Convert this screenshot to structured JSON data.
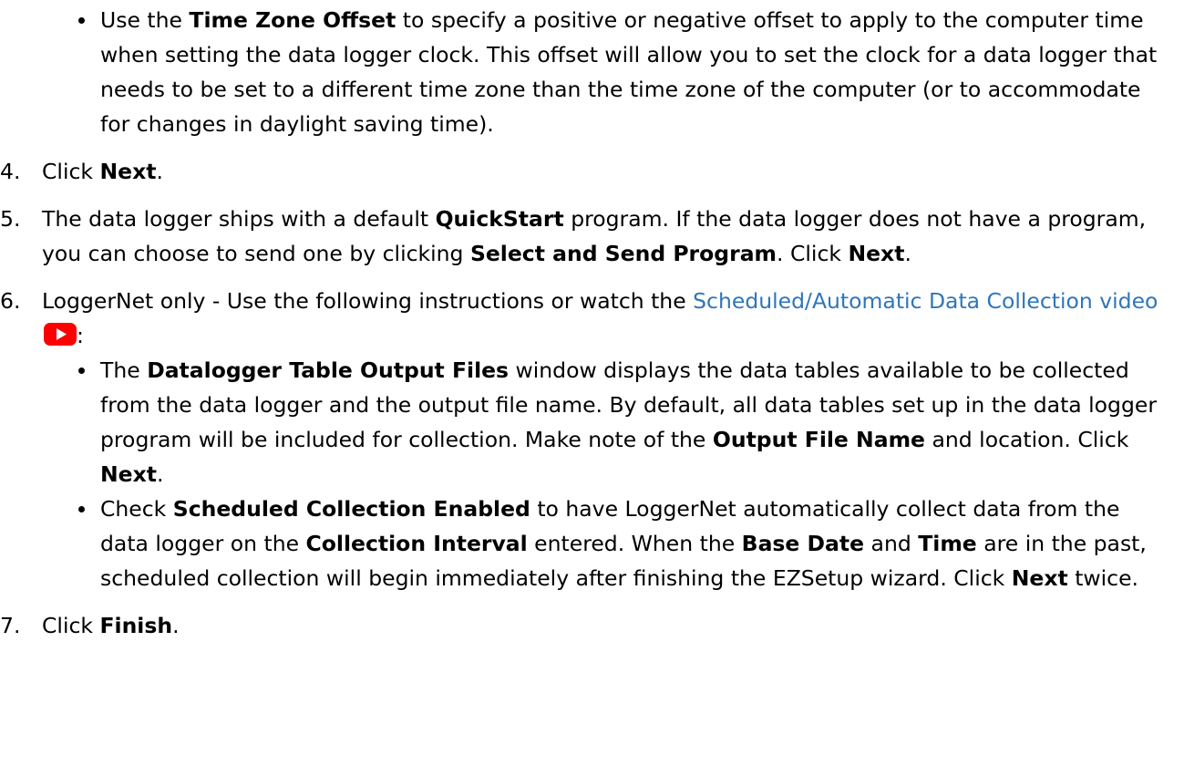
{
  "bullet_time_zone": {
    "pre": "Use the ",
    "bold": "Time Zone Offset",
    "post": " to specify a positive or negative offset to apply to the computer time when setting the data logger clock. This offset will allow you to set the clock for a data logger that needs to be set to a different time zone than the time zone of the computer (or to accommodate for changes in daylight saving time)."
  },
  "step4": {
    "number": "4.",
    "pre": "Click ",
    "bold": "Next",
    "post": "."
  },
  "step5": {
    "number": "5.",
    "t1": "The data logger ships with a default ",
    "b1": "QuickStart",
    "t2": " program. If the data logger does not have a program, you can choose to send one by clicking ",
    "b2": "Select and Send Program",
    "t3": ". Click ",
    "b3": "Next",
    "t4": "."
  },
  "step6": {
    "number": "6.",
    "pre": "LoggerNet only - Use the following instructions or watch the ",
    "link": "Scheduled/Automatic Data Collection video",
    "post": ":",
    "icon": "youtube-play-icon",
    "bullet1": {
      "t1": "The ",
      "b1": "Datalogger Table Output Files",
      "t2": " window displays the data tables available to be collected from the data logger and the output file name. By default, all data tables set up in the data logger program will be included for collection. Make note of the ",
      "b2": "Output File Name",
      "t3": " and location. Click ",
      "b3": "Next",
      "t4": "."
    },
    "bullet2": {
      "t1": "Check ",
      "b1": "Scheduled Collection Enabled",
      "t2": " to have LoggerNet automatically collect data from the data logger on the ",
      "b2": "Collection Interval",
      "t3": " entered. When the ",
      "b3": "Base Date",
      "t4": " and ",
      "b4": "Time",
      "t5": " are in the past, scheduled collection will begin immediately after finishing the EZSetup wizard. Click ",
      "b5": "Next",
      "t6": " twice."
    }
  },
  "step7": {
    "number": "7.",
    "pre": "Click ",
    "bold": "Finish",
    "post": "."
  },
  "colors": {
    "text": "#000000",
    "link": "#2e76b9",
    "youtube_red": "#ff0000"
  }
}
